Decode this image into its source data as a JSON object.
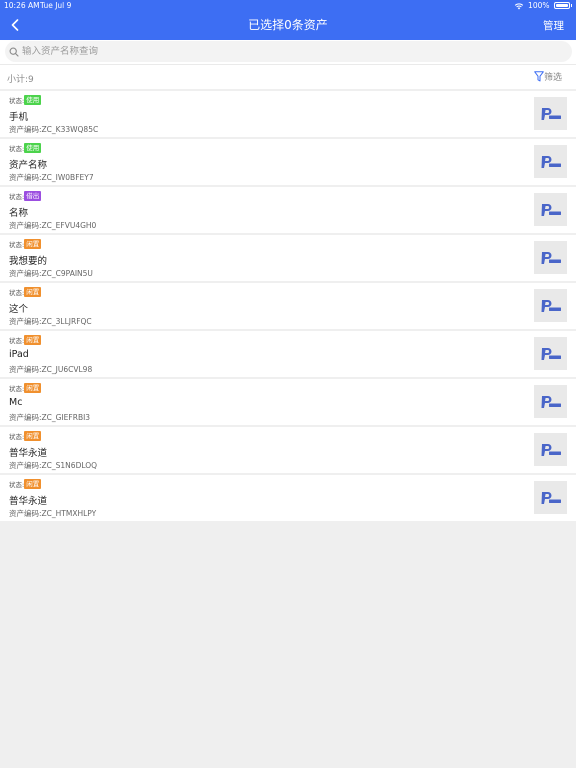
{
  "status_bar": {
    "time": "10:26 AM",
    "date": "Tue Jul 9",
    "battery": "100%"
  },
  "header": {
    "title": "已选择0条资产",
    "manage_label": "管理"
  },
  "search": {
    "placeholder": "输入资产名称查询",
    "value": ""
  },
  "summary": {
    "subtotal": "小计:9",
    "filter_label": "筛选"
  },
  "labels": {
    "status": "状态:"
  },
  "assets": [
    {
      "status": "使用",
      "status_color": "#4cd34c",
      "name": "手机",
      "code": "资产编码:ZC_K33WQ85C"
    },
    {
      "status": "使用",
      "status_color": "#4cd34c",
      "name": "资产名称",
      "code": "资产编码:ZC_IW0BFEY7"
    },
    {
      "status": "借出",
      "status_color": "#9b4ee0",
      "name": "名称",
      "code": "资产编码:ZC_EFVU4GH0"
    },
    {
      "status": "闲置",
      "status_color": "#f0902e",
      "name": "我想要的",
      "code": "资产编码:ZC_C9PAIN5U"
    },
    {
      "status": "闲置",
      "status_color": "#f0902e",
      "name": "这个",
      "code": "资产编码:ZC_3LLJRFQC"
    },
    {
      "status": "闲置",
      "status_color": "#f0902e",
      "name": "iPad",
      "code": "资产编码:ZC_JU6CVL98"
    },
    {
      "status": "闲置",
      "status_color": "#f0902e",
      "name": "Mc",
      "code": "资产编码:ZC_GIEFRBI3"
    },
    {
      "status": "闲置",
      "status_color": "#f0902e",
      "name": "普华永道",
      "code": "资产编码:ZC_S1N6DLOQ"
    },
    {
      "status": "闲置",
      "status_color": "#f0902e",
      "name": "普华永道",
      "code": "资产编码:ZC_HTMXHLPY"
    }
  ],
  "colors": {
    "header_bg": "#3d6ef3",
    "logo": "#4a66c9"
  }
}
